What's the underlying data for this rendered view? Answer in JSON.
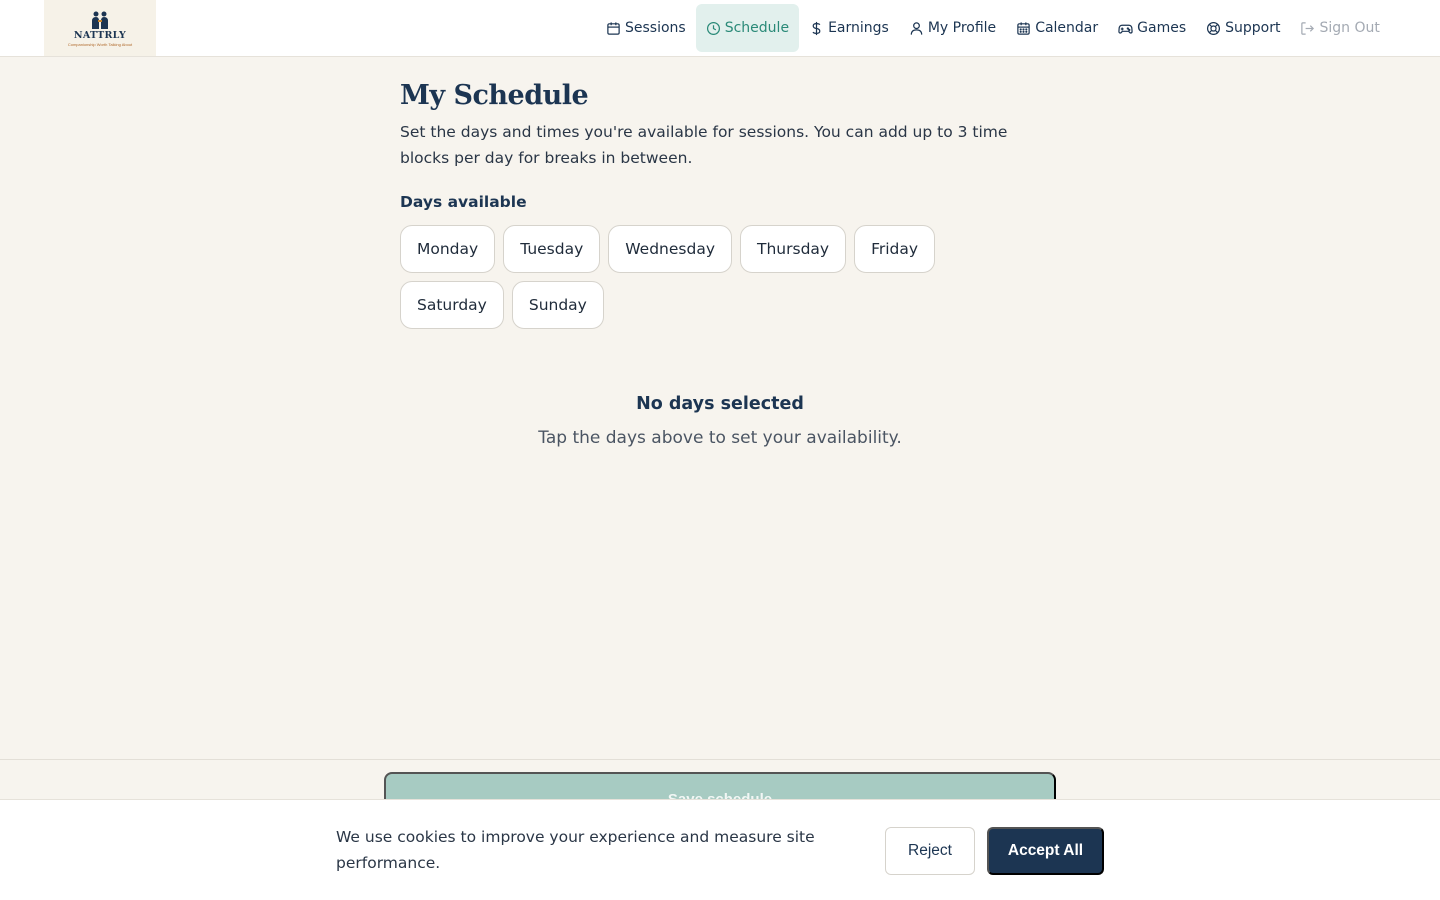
{
  "brand": {
    "name": "NATTRLY",
    "tagline": "Companionship Worth Talking About"
  },
  "nav": {
    "items": [
      {
        "label": "Sessions",
        "icon": "calendar-icon",
        "active": false
      },
      {
        "label": "Schedule",
        "icon": "clock-icon",
        "active": true
      },
      {
        "label": "Earnings",
        "icon": "dollar-icon",
        "active": false
      },
      {
        "label": "My Profile",
        "icon": "user-icon",
        "active": false
      },
      {
        "label": "Calendar",
        "icon": "calendar-grid-icon",
        "active": false
      },
      {
        "label": "Games",
        "icon": "gamepad-icon",
        "active": false
      },
      {
        "label": "Support",
        "icon": "lifebuoy-icon",
        "active": false
      },
      {
        "label": "Sign Out",
        "icon": "sign-out-icon",
        "active": false
      }
    ]
  },
  "page": {
    "title": "My Schedule",
    "description": "Set the days and times you're available for sessions. You can add up to 3 time blocks per day for breaks in between.",
    "days_label": "Days available",
    "days": [
      "Monday",
      "Tuesday",
      "Wednesday",
      "Thursday",
      "Friday",
      "Saturday",
      "Sunday"
    ],
    "empty_title": "No days selected",
    "empty_subtitle": "Tap the days above to set your availability.",
    "save_label": "Save schedule"
  },
  "cookie": {
    "text": "We use cookies to improve your experience and measure site performance.",
    "reject_label": "Reject",
    "accept_label": "Accept All"
  },
  "colors": {
    "primary": "#1c3552",
    "accent": "#2a8a78",
    "accent_bg": "#e2f0ed",
    "background": "#f7f4ee",
    "save_disabled": "#a7cbc2"
  }
}
